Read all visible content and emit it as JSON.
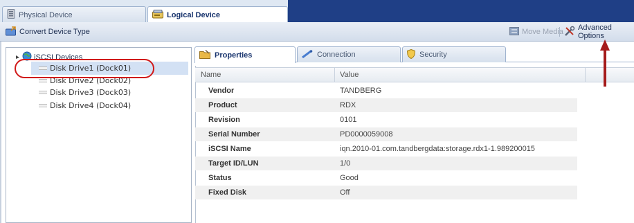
{
  "top_tabs": [
    {
      "label": "Physical Device",
      "icon": "server-icon",
      "active": false
    },
    {
      "label": "Logical Device",
      "icon": "disk-icon",
      "active": true
    }
  ],
  "toolbar": {
    "convert_label": "Convert Device Type",
    "move_media_label": "Move Media",
    "advanced_label": "Advanced Options"
  },
  "tree": {
    "root_label": "iSCSI Devices",
    "items": [
      {
        "label": "Disk Drive1 (Dock01)",
        "selected": true
      },
      {
        "label": "Disk Drive2 (Dock02)",
        "selected": false
      },
      {
        "label": "Disk Drive3 (Dock03)",
        "selected": false
      },
      {
        "label": "Disk Drive4 (Dock04)",
        "selected": false
      }
    ]
  },
  "sub_tabs": [
    {
      "label": "Properties",
      "icon": "folder-icon",
      "active": true
    },
    {
      "label": "Connection",
      "icon": "cable-icon",
      "active": false
    },
    {
      "label": "Security",
      "icon": "shield-icon",
      "active": false
    }
  ],
  "grid": {
    "col_name": "Name",
    "col_value": "Value",
    "rows": [
      {
        "name": "Vendor",
        "value": "TANDBERG"
      },
      {
        "name": "Product",
        "value": "RDX"
      },
      {
        "name": "Revision",
        "value": "0101"
      },
      {
        "name": "Serial Number",
        "value": "PD0000059008"
      },
      {
        "name": "iSCSI Name",
        "value": "iqn.2010-01.com.tandbergdata:storage.rdx1-1.989200015"
      },
      {
        "name": "Target ID/LUN",
        "value": "1/0"
      },
      {
        "name": "Status",
        "value": "Good"
      },
      {
        "name": "Fixed Disk",
        "value": "Off"
      }
    ]
  },
  "colors": {
    "accent_dark": "#1f3f86",
    "highlight_red": "#d11a1a",
    "selection": "#d3e1f4"
  }
}
